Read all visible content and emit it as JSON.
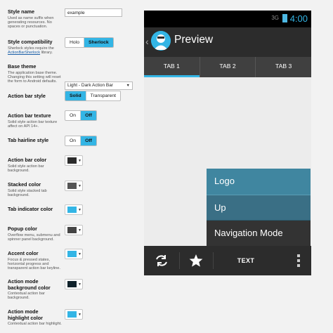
{
  "form": {
    "style_name": {
      "label": "Style name",
      "desc": "Used as name suffix when generating resources. No spaces or punctuation.",
      "value": "example"
    },
    "style_compat": {
      "label": "Style compatibility",
      "desc_pre": "Sherlock styles require the",
      "desc_link": "ActionBarSherlock",
      "desc_post": "library.",
      "options": [
        "Holo",
        "Sherlock"
      ],
      "selected": "Sherlock"
    },
    "base_theme": {
      "label": "Base theme",
      "desc": "The application base theme. Changing this setting will reset the form to Android defaults.",
      "value": "Light - Dark Action Bar"
    },
    "action_bar_style": {
      "label": "Action bar style",
      "options": [
        "Solid",
        "Transparent"
      ],
      "selected": "Solid"
    },
    "action_bar_texture": {
      "label": "Action bar texture",
      "desc": "Solid style action bar texture affect on API 14+.",
      "options": [
        "On",
        "Off"
      ],
      "selected": "Off"
    },
    "tab_hairline": {
      "label": "Tab hairline style",
      "options": [
        "On",
        "Off"
      ],
      "selected": "Off"
    },
    "action_bar_color": {
      "label": "Action bar color",
      "desc": "Solid style action bar background.",
      "color": "#2b2b2b"
    },
    "stacked_color": {
      "label": "Stacked color",
      "desc": "Solid style stacked tab background.",
      "color": "#555555"
    },
    "tab_indicator_color": {
      "label": "Tab indicator color",
      "color": "#33b5e5"
    },
    "popup_color": {
      "label": "Popup color",
      "desc": "Overflow menu, submenu and spinner panel background.",
      "color": "#444444"
    },
    "accent_color": {
      "label": "Accent color",
      "desc": "Focus & pressed states, horizontal progress and transparent action bar keyline.",
      "color": "#33b5e5"
    },
    "action_mode_bg": {
      "label": "Action mode background color",
      "desc": "Contextual action bar background.",
      "color": "#10222b"
    },
    "action_mode_highlight": {
      "label": "Action mode highlight color",
      "desc": "Contextual action bar highlight.",
      "color": "#33b5e5"
    }
  },
  "preview": {
    "status": {
      "network": "3G",
      "time": "4:00"
    },
    "title": "Preview",
    "tabs": [
      "TAB 1",
      "TAB 2",
      "TAB 3"
    ],
    "active_tab": "TAB 1",
    "menu": [
      "Logo",
      "Up",
      "Navigation Mode"
    ],
    "bottom": {
      "text_button": "TEXT"
    },
    "colors": {
      "accent": "#33b5e5",
      "actionbar": "#2c2c2c",
      "tabs": "#404040",
      "menu_logo": "#4086a0",
      "menu_up": "#3a6f85"
    }
  }
}
